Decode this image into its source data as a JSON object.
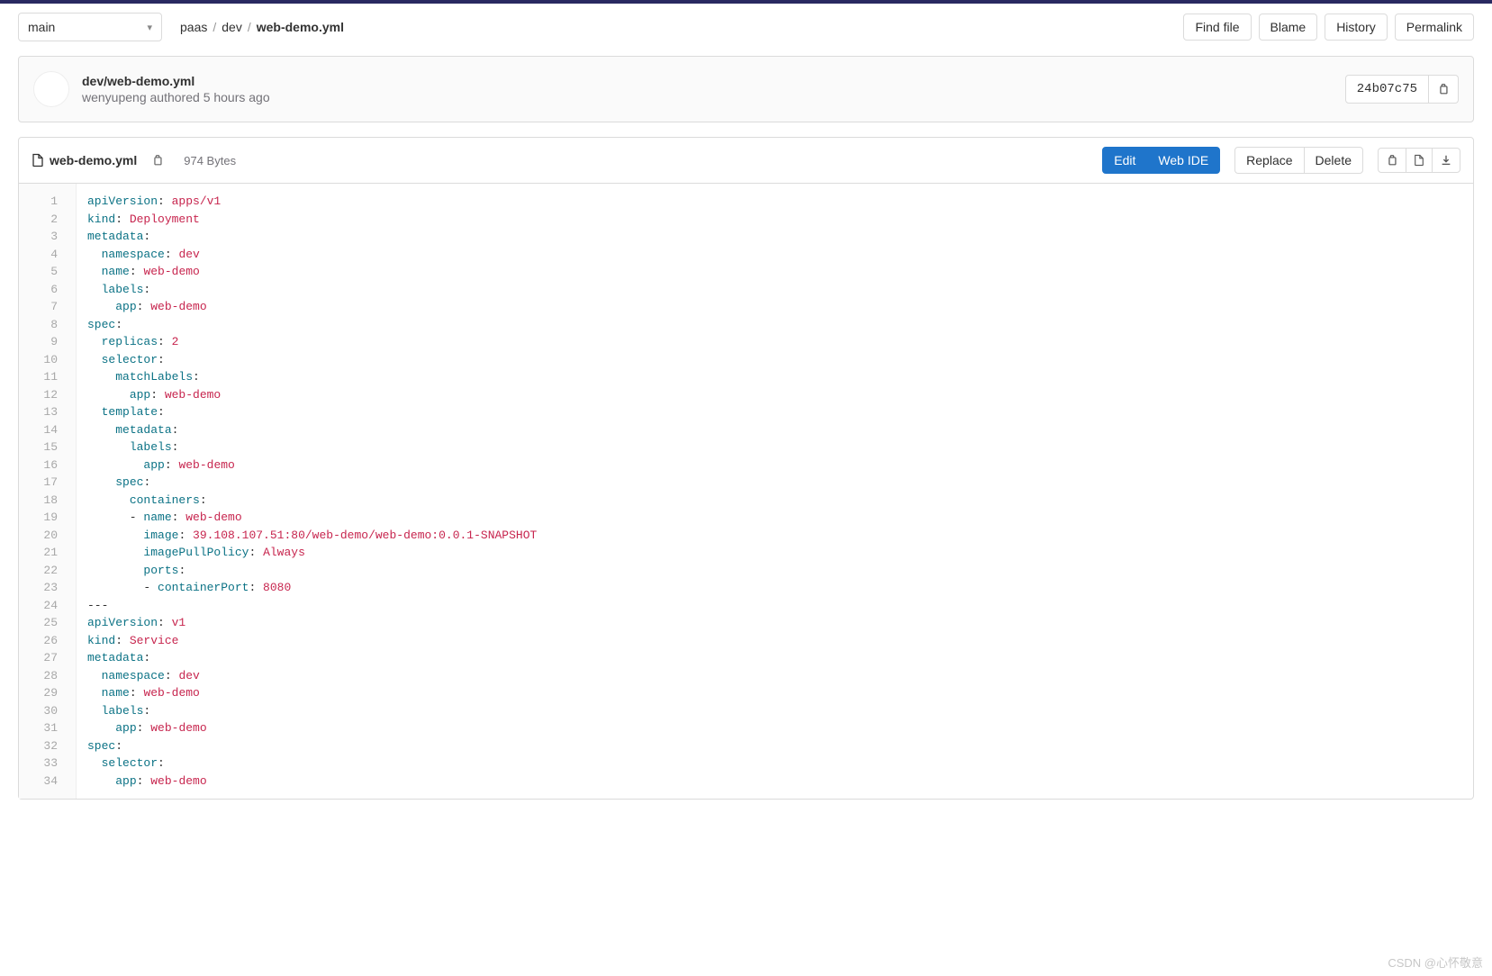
{
  "branch": "main",
  "breadcrumb": {
    "root": "paas",
    "mid": "dev",
    "current": "web-demo.yml"
  },
  "actions": {
    "find_file": "Find file",
    "blame": "Blame",
    "history": "History",
    "permalink": "Permalink"
  },
  "commit": {
    "title": "dev/web-demo.yml",
    "author": "wenyupeng",
    "verb": "authored",
    "when": "5 hours ago",
    "sha": "24b07c75"
  },
  "file": {
    "name": "web-demo.yml",
    "size": "974 Bytes",
    "buttons": {
      "edit": "Edit",
      "webide": "Web IDE",
      "replace": "Replace",
      "delete": "Delete"
    }
  },
  "code_lines": [
    [
      [
        "k",
        "apiVersion"
      ],
      [
        "d",
        ": "
      ],
      [
        "v",
        "apps/v1"
      ]
    ],
    [
      [
        "k",
        "kind"
      ],
      [
        "d",
        ": "
      ],
      [
        "v",
        "Deployment"
      ]
    ],
    [
      [
        "k",
        "metadata"
      ],
      [
        "d",
        ":"
      ]
    ],
    [
      [
        "d",
        "  "
      ],
      [
        "k",
        "namespace"
      ],
      [
        "d",
        ": "
      ],
      [
        "v",
        "dev"
      ]
    ],
    [
      [
        "d",
        "  "
      ],
      [
        "k",
        "name"
      ],
      [
        "d",
        ": "
      ],
      [
        "v",
        "web-demo"
      ]
    ],
    [
      [
        "d",
        "  "
      ],
      [
        "k",
        "labels"
      ],
      [
        "d",
        ":"
      ]
    ],
    [
      [
        "d",
        "    "
      ],
      [
        "k",
        "app"
      ],
      [
        "d",
        ": "
      ],
      [
        "v",
        "web-demo"
      ]
    ],
    [
      [
        "k",
        "spec"
      ],
      [
        "d",
        ":"
      ]
    ],
    [
      [
        "d",
        "  "
      ],
      [
        "k",
        "replicas"
      ],
      [
        "d",
        ": "
      ],
      [
        "v",
        "2"
      ]
    ],
    [
      [
        "d",
        "  "
      ],
      [
        "k",
        "selector"
      ],
      [
        "d",
        ":"
      ]
    ],
    [
      [
        "d",
        "    "
      ],
      [
        "k",
        "matchLabels"
      ],
      [
        "d",
        ":"
      ]
    ],
    [
      [
        "d",
        "      "
      ],
      [
        "k",
        "app"
      ],
      [
        "d",
        ": "
      ],
      [
        "v",
        "web-demo"
      ]
    ],
    [
      [
        "d",
        "  "
      ],
      [
        "k",
        "template"
      ],
      [
        "d",
        ":"
      ]
    ],
    [
      [
        "d",
        "    "
      ],
      [
        "k",
        "metadata"
      ],
      [
        "d",
        ":"
      ]
    ],
    [
      [
        "d",
        "      "
      ],
      [
        "k",
        "labels"
      ],
      [
        "d",
        ":"
      ]
    ],
    [
      [
        "d",
        "        "
      ],
      [
        "k",
        "app"
      ],
      [
        "d",
        ": "
      ],
      [
        "v",
        "web-demo"
      ]
    ],
    [
      [
        "d",
        "    "
      ],
      [
        "k",
        "spec"
      ],
      [
        "d",
        ":"
      ]
    ],
    [
      [
        "d",
        "      "
      ],
      [
        "k",
        "containers"
      ],
      [
        "d",
        ":"
      ]
    ],
    [
      [
        "d",
        "      - "
      ],
      [
        "k",
        "name"
      ],
      [
        "d",
        ": "
      ],
      [
        "v",
        "web-demo"
      ]
    ],
    [
      [
        "d",
        "        "
      ],
      [
        "k",
        "image"
      ],
      [
        "d",
        ": "
      ],
      [
        "v",
        "39.108.107.51:80/web-demo/web-demo:0.0.1-SNAPSHOT"
      ]
    ],
    [
      [
        "d",
        "        "
      ],
      [
        "k",
        "imagePullPolicy"
      ],
      [
        "d",
        ": "
      ],
      [
        "v",
        "Always"
      ]
    ],
    [
      [
        "d",
        "        "
      ],
      [
        "k",
        "ports"
      ],
      [
        "d",
        ":"
      ]
    ],
    [
      [
        "d",
        "        - "
      ],
      [
        "k",
        "containerPort"
      ],
      [
        "d",
        ": "
      ],
      [
        "v",
        "8080"
      ]
    ],
    [
      [
        "d",
        "---"
      ]
    ],
    [
      [
        "k",
        "apiVersion"
      ],
      [
        "d",
        ": "
      ],
      [
        "v",
        "v1"
      ]
    ],
    [
      [
        "k",
        "kind"
      ],
      [
        "d",
        ": "
      ],
      [
        "v",
        "Service"
      ]
    ],
    [
      [
        "k",
        "metadata"
      ],
      [
        "d",
        ":"
      ]
    ],
    [
      [
        "d",
        "  "
      ],
      [
        "k",
        "namespace"
      ],
      [
        "d",
        ": "
      ],
      [
        "v",
        "dev"
      ]
    ],
    [
      [
        "d",
        "  "
      ],
      [
        "k",
        "name"
      ],
      [
        "d",
        ": "
      ],
      [
        "v",
        "web-demo"
      ]
    ],
    [
      [
        "d",
        "  "
      ],
      [
        "k",
        "labels"
      ],
      [
        "d",
        ":"
      ]
    ],
    [
      [
        "d",
        "    "
      ],
      [
        "k",
        "app"
      ],
      [
        "d",
        ": "
      ],
      [
        "v",
        "web-demo"
      ]
    ],
    [
      [
        "k",
        "spec"
      ],
      [
        "d",
        ":"
      ]
    ],
    [
      [
        "d",
        "  "
      ],
      [
        "k",
        "selector"
      ],
      [
        "d",
        ":"
      ]
    ],
    [
      [
        "d",
        "    "
      ],
      [
        "k",
        "app"
      ],
      [
        "d",
        ": "
      ],
      [
        "v",
        "web-demo"
      ]
    ]
  ],
  "watermark": "CSDN @心怀敬意"
}
